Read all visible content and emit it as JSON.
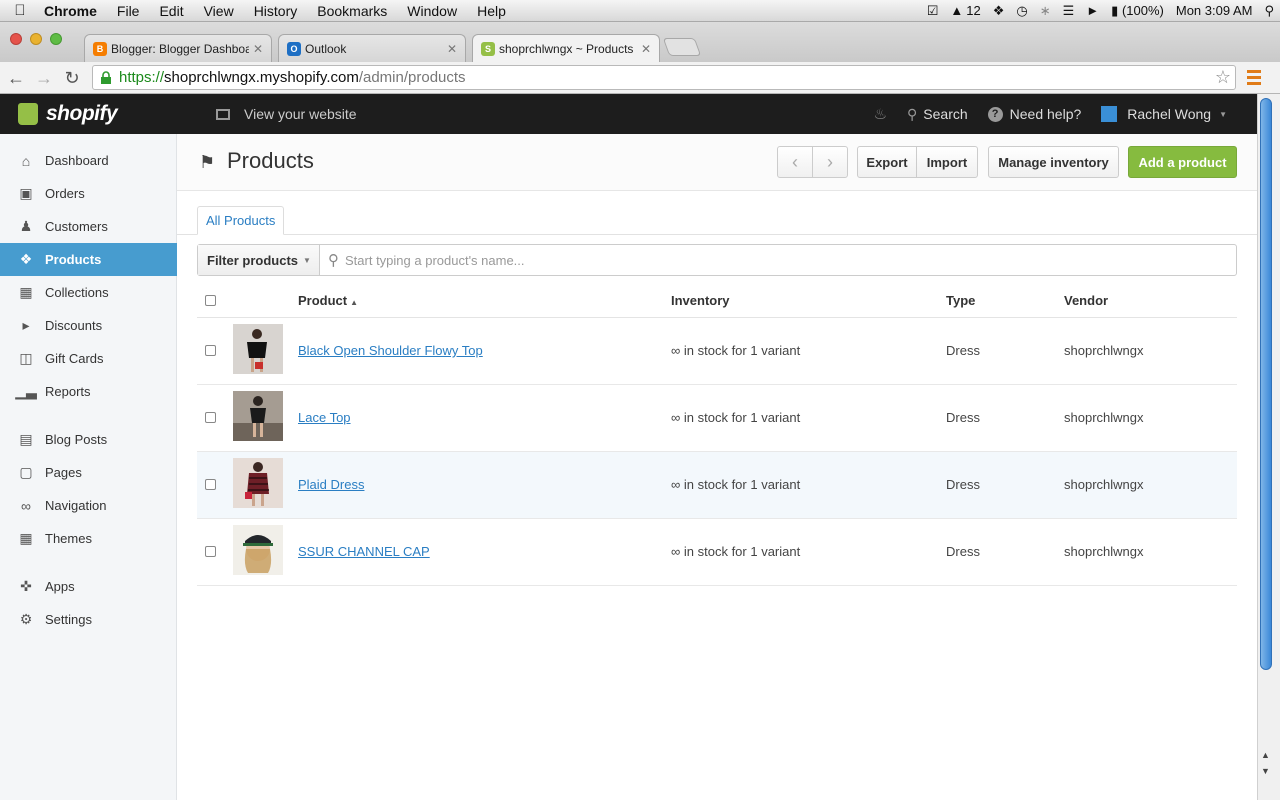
{
  "os_menu": {
    "app": "Chrome",
    "items": [
      "File",
      "Edit",
      "View",
      "History",
      "Bookmarks",
      "Window",
      "Help"
    ],
    "status_count": "12",
    "battery": "(100%)",
    "clock": "Mon 3:09 AM"
  },
  "browser": {
    "tabs": [
      {
        "title": "Blogger: Blogger Dashboar",
        "favicon_color": "#f57d00",
        "favicon_glyph": "B"
      },
      {
        "title": "Outlook",
        "favicon_color": "#1e6fc4",
        "favicon_glyph": "O"
      },
      {
        "title": "shoprchlwngx ~ Products",
        "favicon_color": "#95bf47",
        "favicon_glyph": "S"
      }
    ],
    "url": {
      "scheme": "https://",
      "host": "shoprchlwngx.myshopify.com",
      "path": "/admin/products"
    }
  },
  "topbar": {
    "brand": "shopify",
    "view_site": "View your website",
    "search": "Search",
    "help": "Need help?",
    "user": "Rachel Wong"
  },
  "sidebar": {
    "items": [
      {
        "label": "Dashboard",
        "icon": "home-icon"
      },
      {
        "label": "Orders",
        "icon": "inbox-icon"
      },
      {
        "label": "Customers",
        "icon": "users-icon"
      },
      {
        "label": "Products",
        "icon": "tag-icon",
        "active": true
      },
      {
        "label": "Collections",
        "icon": "box-icon"
      },
      {
        "label": "Discounts",
        "icon": "megaphone-icon"
      },
      {
        "label": "Gift Cards",
        "icon": "gift-icon"
      },
      {
        "label": "Reports",
        "icon": "bar-chart-icon"
      },
      {
        "label": "Blog Posts",
        "icon": "blog-icon"
      },
      {
        "label": "Pages",
        "icon": "pages-icon"
      },
      {
        "label": "Navigation",
        "icon": "link-icon"
      },
      {
        "label": "Themes",
        "icon": "image-icon"
      },
      {
        "label": "Apps",
        "icon": "puzzle-icon"
      },
      {
        "label": "Settings",
        "icon": "gear-icon"
      }
    ]
  },
  "page": {
    "title": "Products",
    "export": "Export",
    "import": "Import",
    "manage_inventory": "Manage inventory",
    "add_product": "Add a product",
    "tab_all": "All Products",
    "filter": "Filter products",
    "search_placeholder": "Start typing a product's name...",
    "columns": {
      "product": "Product",
      "inventory": "Inventory",
      "type": "Type",
      "vendor": "Vendor"
    },
    "products": [
      {
        "name": "Black Open Shoulder Flowy Top",
        "inventory": "∞ in stock for 1 variant",
        "type": "Dress",
        "vendor": "shoprchlwngx"
      },
      {
        "name": "Lace Top",
        "inventory": "∞ in stock for 1 variant",
        "type": "Dress",
        "vendor": "shoprchlwngx"
      },
      {
        "name": "Plaid Dress",
        "inventory": "∞ in stock for 1 variant",
        "type": "Dress",
        "vendor": "shoprchlwngx"
      },
      {
        "name": "SSUR CHANNEL CAP",
        "inventory": "∞ in stock for 1 variant",
        "type": "Dress",
        "vendor": "shoprchlwngx"
      }
    ]
  },
  "colors": {
    "sidebar_active": "#479ccf",
    "primary_button": "#86bb3f",
    "link": "#2a7ec3",
    "topbar": "#1d1d1d"
  }
}
